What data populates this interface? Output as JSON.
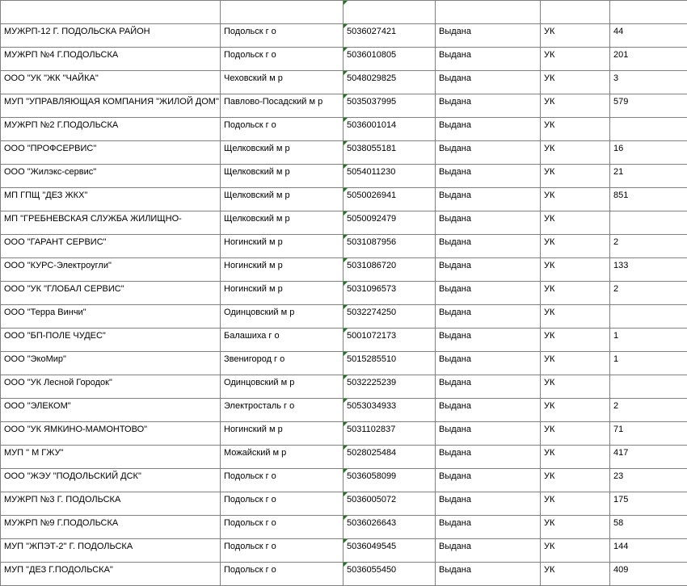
{
  "rows": [
    {
      "c0": "",
      "c1": "",
      "c2": "",
      "c3": "",
      "c4": "",
      "c5": ""
    },
    {
      "c0": "МУЖРП-12 Г. ПОДОЛЬСКА РАЙОН",
      "c1": "Подольск г о",
      "c2": "5036027421",
      "c3": "Выдана",
      "c4": "УК",
      "c5": "44"
    },
    {
      "c0": "МУЖРП №4 Г.ПОДОЛЬСКА",
      "c1": "Подольск г о",
      "c2": "5036010805",
      "c3": "Выдана",
      "c4": "УК",
      "c5": "201"
    },
    {
      "c0": "ООО \"УК \"ЖК \"ЧАЙКА\"",
      "c1": "Чеховский м р",
      "c2": "5048029825",
      "c3": "Выдана",
      "c4": "УК",
      "c5": "3"
    },
    {
      "c0": "МУП \"УПРАВЛЯЮЩАЯ КОМПАНИЯ \"ЖИЛОЙ ДОМ\"",
      "c1": "Павлово-Посадский м р",
      "c2": "5035037995",
      "c3": "Выдана",
      "c4": "УК",
      "c5": "579"
    },
    {
      "c0": "МУЖРП №2 Г.ПОДОЛЬСКА",
      "c1": "Подольск г о",
      "c2": "5036001014",
      "c3": "Выдана",
      "c4": "УК",
      "c5": ""
    },
    {
      "c0": "ООО \"ПРОФСЕРВИС\"",
      "c1": "Щелковский м р",
      "c2": "5038055181",
      "c3": "Выдана",
      "c4": "УК",
      "c5": "16"
    },
    {
      "c0": "ООО \"Жилэкс-сервис\"",
      "c1": "Щелковский м р",
      "c2": "5054011230",
      "c3": "Выдана",
      "c4": "УК",
      "c5": "21"
    },
    {
      "c0": "МП ГПЩ \"ДЕЗ ЖКХ\"",
      "c1": "Щелковский м р",
      "c2": "5050026941",
      "c3": "Выдана",
      "c4": "УК",
      "c5": "851"
    },
    {
      "c0": "МП \"ГРЕБНЕВСКАЯ СЛУЖБА ЖИЛИЩНО-",
      "c1": "Щелковский м р",
      "c2": "5050092479",
      "c3": "Выдана",
      "c4": "УК",
      "c5": ""
    },
    {
      "c0": "ООО \"ГАРАНТ СЕРВИС\"",
      "c1": "Ногинский м р",
      "c2": "5031087956",
      "c3": "Выдана",
      "c4": "УК",
      "c5": "2"
    },
    {
      "c0": "ООО \"КУРС-Электроугли\"",
      "c1": "Ногинский м р",
      "c2": "5031086720",
      "c3": "Выдана",
      "c4": "УК",
      "c5": "133"
    },
    {
      "c0": "ООО \"УК \"ГЛОБАЛ СЕРВИС\"",
      "c1": "Ногинский м р",
      "c2": "5031096573",
      "c3": "Выдана",
      "c4": "УК",
      "c5": "2"
    },
    {
      "c0": "ООО \"Терра Винчи\"",
      "c1": "Одинцовский м р",
      "c2": "5032274250",
      "c3": "Выдана",
      "c4": "УК",
      "c5": ""
    },
    {
      "c0": "ООО \"БП-ПОЛЕ ЧУДЕС\"",
      "c1": "Балашиха г о",
      "c2": "5001072173",
      "c3": "Выдана",
      "c4": "УК",
      "c5": "1"
    },
    {
      "c0": "ООО \"ЭкоМир\"",
      "c1": "Звенигород г о",
      "c2": "5015285510",
      "c3": "Выдана",
      "c4": "УК",
      "c5": "1"
    },
    {
      "c0": "ООО \"УК Лесной Городок\"",
      "c1": "Одинцовский м р",
      "c2": "5032225239",
      "c3": "Выдана",
      "c4": "УК",
      "c5": ""
    },
    {
      "c0": "ООО \"ЭЛЕКОМ\"",
      "c1": "Электросталь г о",
      "c2": "5053034933",
      "c3": "Выдана",
      "c4": "УК",
      "c5": "2"
    },
    {
      "c0": "ООО \"УК ЯМКИНО-МАМОНТОВО\"",
      "c1": "Ногинский м р",
      "c2": "5031102837",
      "c3": "Выдана",
      "c4": "УК",
      "c5": "71"
    },
    {
      "c0": "МУП \" М ГЖУ\"",
      "c1": "Можайский м р",
      "c2": "5028025484",
      "c3": "Выдана",
      "c4": "УК",
      "c5": "417"
    },
    {
      "c0": "ООО \"ЖЭУ \"ПОДОЛЬСКИЙ ДСК\"",
      "c1": "Подольск г о",
      "c2": "5036058099",
      "c3": "Выдана",
      "c4": "УК",
      "c5": "23"
    },
    {
      "c0": "МУЖРП №3 Г. ПОДОЛЬСКА",
      "c1": "Подольск г о",
      "c2": "5036005072",
      "c3": "Выдана",
      "c4": "УК",
      "c5": "175"
    },
    {
      "c0": "МУЖРП №9 Г.ПОДОЛЬСКА",
      "c1": "Подольск г о",
      "c2": "5036026643",
      "c3": "Выдана",
      "c4": "УК",
      "c5": "58"
    },
    {
      "c0": "МУП \"ЖПЭТ-2\" Г. ПОДОЛЬСКА",
      "c1": "Подольск г о",
      "c2": "5036049545",
      "c3": "Выдана",
      "c4": "УК",
      "c5": "144"
    },
    {
      "c0": "МУП \"ДЕЗ Г.ПОДОЛЬСКА\"",
      "c1": "Подольск г о",
      "c2": "5036055450",
      "c3": "Выдана",
      "c4": "УК",
      "c5": "409"
    }
  ]
}
